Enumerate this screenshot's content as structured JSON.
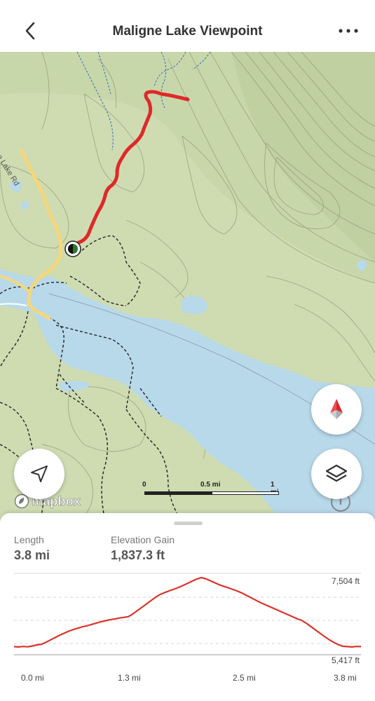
{
  "header": {
    "title": "Maligne Lake Viewpoint",
    "back_icon": "chevron-left-icon",
    "more_icon": "more-horizontal-icon"
  },
  "map": {
    "road_label": "ligne Lake Rd",
    "scale": {
      "labels": [
        "0",
        "0.5 mi",
        "1 mi"
      ]
    },
    "attribution_logo_text": "mapbox",
    "attribution_info": "i",
    "colors": {
      "land": "#cfdcb2",
      "water": "#b8d9ea",
      "trail": "#e0282a",
      "road": "#f5d77a",
      "contour": "#8c9474"
    },
    "buttons": {
      "compass_icon": "compass-icon",
      "layers_icon": "layers-icon",
      "locate_icon": "navigation-arrow-icon"
    }
  },
  "stats": {
    "length": {
      "label": "Length",
      "value": "3.8 mi"
    },
    "gain": {
      "label": "Elevation Gain",
      "value": "1,837.3 ft"
    }
  },
  "chart_data": {
    "type": "area",
    "title": "",
    "xlabel": "",
    "ylabel": "",
    "x_tick_labels": [
      "0.0 mi",
      "1.3 mi",
      "2.5 mi",
      "3.8 mi"
    ],
    "y_tick_labels": [
      "7,504 ft",
      "5,417 ft"
    ],
    "xlim": [
      0,
      3.8
    ],
    "ylim": [
      5417,
      7504
    ],
    "grid": true,
    "series": [
      {
        "color": "#d9342b",
        "x": [
          0.0,
          0.05,
          0.1,
          0.15,
          0.2,
          0.25,
          0.3,
          0.35,
          0.4,
          0.45,
          0.5,
          0.55,
          0.6,
          0.65,
          0.7,
          0.75,
          0.8,
          0.85,
          0.9,
          0.95,
          1.0,
          1.05,
          1.1,
          1.15,
          1.2,
          1.25,
          1.3,
          1.35,
          1.4,
          1.45,
          1.5,
          1.55,
          1.6,
          1.65,
          1.7,
          1.75,
          1.8,
          1.85,
          1.9,
          1.95,
          2.0,
          2.05,
          2.1,
          2.15,
          2.2,
          2.25,
          2.3,
          2.35,
          2.4,
          2.45,
          2.5,
          2.55,
          2.6,
          2.65,
          2.7,
          2.75,
          2.8,
          2.85,
          2.9,
          2.95,
          3.0,
          3.05,
          3.1,
          3.15,
          3.2,
          3.25,
          3.3,
          3.35,
          3.4,
          3.45,
          3.5,
          3.55,
          3.6,
          3.65,
          3.7,
          3.75,
          3.8
        ],
        "y": [
          5450,
          5440,
          5455,
          5445,
          5470,
          5500,
          5520,
          5580,
          5650,
          5720,
          5790,
          5850,
          5910,
          5960,
          6000,
          6040,
          6070,
          6110,
          6150,
          6190,
          6220,
          6250,
          6270,
          6300,
          6320,
          6340,
          6420,
          6520,
          6620,
          6720,
          6820,
          6920,
          7000,
          7060,
          7110,
          7160,
          7210,
          7270,
          7330,
          7400,
          7460,
          7504,
          7470,
          7410,
          7350,
          7290,
          7240,
          7200,
          7150,
          7100,
          7040,
          6970,
          6900,
          6830,
          6760,
          6700,
          6640,
          6580,
          6520,
          6460,
          6400,
          6340,
          6280,
          6230,
          6150,
          6050,
          5950,
          5850,
          5750,
          5660,
          5580,
          5510,
          5460,
          5450,
          5440,
          5455,
          5450
        ]
      }
    ]
  }
}
